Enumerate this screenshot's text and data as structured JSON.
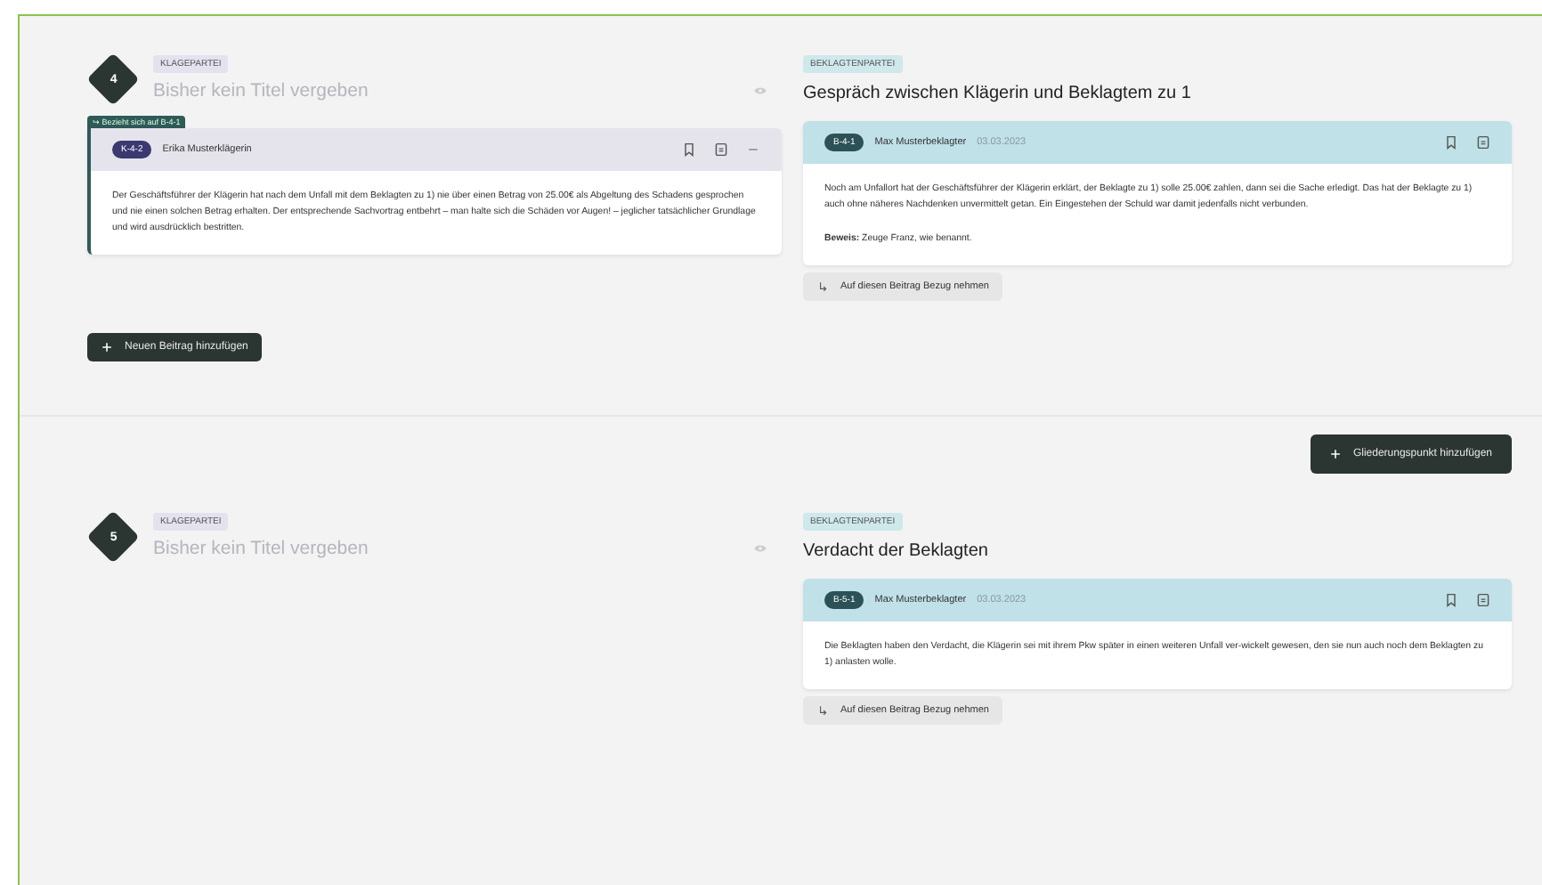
{
  "sections": [
    {
      "number": "4",
      "left": {
        "party_tag": "KLAGEPARTEI",
        "title_placeholder": "Bisher kein Titel vergeben",
        "entries": [
          {
            "kind": "plaintiff",
            "reference": "↪ Bezieht sich auf B-4-1",
            "badge": "K-4-2",
            "author": "Erika Musterklägerin",
            "paragraphs": [
              "Der Geschäftsführer der Klägerin hat nach dem Unfall mit dem Beklagten zu 1) nie über einen Betrag von 25.00€ als Abgeltung des Schadens gesprochen und nie einen solchen Betrag erhalten. Der entsprechende Sachvortrag entbehrt – man halte sich die Schäden vor Augen! – jeglicher tatsächlicher Grundlage und wird ausdrücklich bestritten."
            ],
            "menu": true
          }
        ],
        "add_button": "Neuen Beitrag hinzufügen"
      },
      "right": {
        "party_tag": "BEKLAGTENPARTEI",
        "title": "Gespräch zwischen Klägerin und Beklagtem zu 1",
        "entries": [
          {
            "kind": "defendant",
            "badge": "B-4-1",
            "author": "Max Musterbeklagter",
            "date": "03.03.2023",
            "paragraphs": [
              "Noch am Unfallort hat der Geschäftsführer der Klägerin erklärt, der Beklagte zu 1) solle 25.00€ zahlen, dann sei die Sache erledigt. Das hat der Beklagte zu 1) auch ohne näheres Nachdenken unvermittelt getan. Ein Eingestehen der Schuld war damit jedenfalls nicht verbunden.",
              "**Beweis:** Zeuge Franz, wie benannt."
            ],
            "menu": false
          }
        ],
        "reference_button": "Auf diesen Beitrag Bezug nehmen"
      }
    },
    {
      "number": "5",
      "left": {
        "party_tag": "KLAGEPARTEI",
        "title_placeholder": "Bisher kein Titel vergeben"
      },
      "right": {
        "party_tag": "BEKLAGTENPARTEI",
        "title": "Verdacht der Beklagten",
        "entries": [
          {
            "kind": "defendant",
            "badge": "B-5-1",
            "author": "Max Musterbeklagter",
            "date": "03.03.2023",
            "paragraphs": [
              "Die Beklagten haben den Verdacht, die Klägerin sei mit ihrem Pkw später in einen weiteren Unfall ver-wickelt gewesen, den sie nun auch noch dem Beklagten zu 1) anlasten wolle."
            ],
            "menu": false
          }
        ],
        "reference_button": "Auf diesen Beitrag Bezug nehmen"
      }
    }
  ],
  "outline_button": "Gliederungspunkt hinzufügen"
}
